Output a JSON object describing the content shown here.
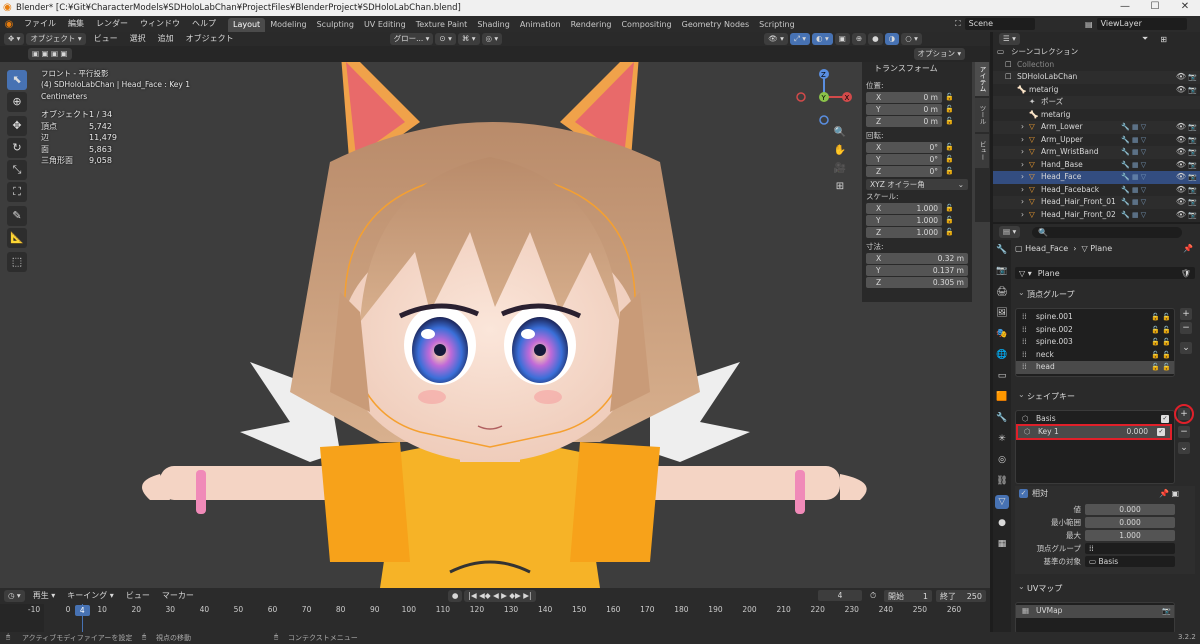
{
  "window": {
    "title": "Blender* [C:¥Git¥CharacterModels¥SDHoloLabChan¥ProjectFiles¥BlenderProject¥SDHoloLabChan.blend]",
    "minimize": "—",
    "maximize": "☐",
    "close": "✕"
  },
  "menu": {
    "items": [
      "ファイル",
      "編集",
      "レンダー",
      "ウィンドウ",
      "ヘルプ"
    ],
    "workspaces": [
      "Layout",
      "Modeling",
      "Sculpting",
      "UV Editing",
      "Texture Paint",
      "Shading",
      "Animation",
      "Rendering",
      "Compositing",
      "Geometry Nodes",
      "Scripting"
    ],
    "active_workspace": "Layout",
    "scene": "Scene",
    "view_layer": "ViewLayer"
  },
  "viewport_header": {
    "mode": "オブジェクト ▾",
    "menus": [
      "ビュー",
      "選択",
      "追加",
      "オブジェクト"
    ],
    "orientation": "グロー... ▾",
    "options": "オプション ▾"
  },
  "viewport_overlay": {
    "view_name": "フロント - 平行投影",
    "context": "(4) SDHoloLabChan | Head_Face : Key 1",
    "units": "Centimeters",
    "stats": [
      {
        "label": "オブジェクト",
        "value": "1 / 34"
      },
      {
        "label": "頂点",
        "value": "5,742"
      },
      {
        "label": "辺",
        "value": "11,479"
      },
      {
        "label": "面",
        "value": "5,863"
      },
      {
        "label": "三角形面",
        "value": "9,058"
      }
    ],
    "gizmo": {
      "x": "X",
      "y": "Y",
      "z": "Z"
    }
  },
  "transform_panel": {
    "title": "トランスフォーム",
    "location_label": "位置:",
    "location": [
      {
        "axis": "X",
        "value": "0 m"
      },
      {
        "axis": "Y",
        "value": "0 m"
      },
      {
        "axis": "Z",
        "value": "0 m"
      }
    ],
    "rotation_label": "回転:",
    "rotation": [
      {
        "axis": "X",
        "value": "0°"
      },
      {
        "axis": "Y",
        "value": "0°"
      },
      {
        "axis": "Z",
        "value": "0°"
      }
    ],
    "rotation_mode": "XYZ オイラー角",
    "scale_label": "スケール:",
    "scale": [
      {
        "axis": "X",
        "value": "1.000"
      },
      {
        "axis": "Y",
        "value": "1.000"
      },
      {
        "axis": "Z",
        "value": "1.000"
      }
    ],
    "dimensions_label": "寸法:",
    "dimensions": [
      {
        "axis": "X",
        "value": "0.32 m"
      },
      {
        "axis": "Y",
        "value": "0.137 m"
      },
      {
        "axis": "Z",
        "value": "0.305 m"
      }
    ]
  },
  "side_tabs": [
    "アイテム",
    "ツール",
    "ビュー"
  ],
  "outliner": {
    "root": "シーンコレクション",
    "rows": [
      {
        "name": "Collection",
        "indent": 1,
        "dim": true
      },
      {
        "name": "SDHoloLabChan",
        "indent": 1,
        "dim": false
      },
      {
        "name": "metarig",
        "indent": 2,
        "dim": false
      },
      {
        "name": "ポーズ",
        "indent": 3,
        "dim": false
      },
      {
        "name": "metarig",
        "indent": 3,
        "dim": false
      },
      {
        "name": "Arm_Lower",
        "indent": 3,
        "dim": false
      },
      {
        "name": "Arm_Upper",
        "indent": 3,
        "dim": false
      },
      {
        "name": "Arm_WristBand",
        "indent": 3,
        "dim": false
      },
      {
        "name": "Hand_Base",
        "indent": 3,
        "dim": false
      },
      {
        "name": "Head_Face",
        "indent": 3,
        "dim": false,
        "selected": true
      },
      {
        "name": "Head_Faceback",
        "indent": 3,
        "dim": false
      },
      {
        "name": "Head_Hair_Front_01",
        "indent": 3,
        "dim": false
      },
      {
        "name": "Head_Hair_Front_02",
        "indent": 3,
        "dim": false
      }
    ]
  },
  "properties": {
    "object_name": "Head_Face",
    "mesh_name": "Plane",
    "datablock": "Plane",
    "vertex_groups_title": "頂点グループ",
    "vertex_groups": [
      "spine.001",
      "spine.002",
      "spine.003",
      "neck",
      "head"
    ],
    "shape_keys_title": "シェイプキー",
    "shape_keys": [
      {
        "name": "Basis",
        "value": ""
      },
      {
        "name": "Key 1",
        "value": "0.000"
      }
    ],
    "relative_label": "相対",
    "fields": [
      {
        "label": "値",
        "value": "0.000"
      },
      {
        "label": "最小範囲",
        "value": "0.000"
      },
      {
        "label": "最大",
        "value": "1.000"
      }
    ],
    "vertex_group_label": "頂点グループ",
    "relative_to_label": "基準の対象",
    "relative_to_value": "Basis",
    "uv_maps_title": "UVマップ",
    "uv_maps": [
      "UVMap"
    ]
  },
  "timeline": {
    "menus": [
      "再生 ▾",
      "キーイング ▾",
      "ビュー",
      "マーカー"
    ],
    "current_frame": "4",
    "start_label": "開始",
    "start": "1",
    "end_label": "終了",
    "end": "250",
    "ticks": [
      "-10",
      "0",
      "10",
      "20",
      "30",
      "40",
      "50",
      "60",
      "70",
      "80",
      "90",
      "100",
      "110",
      "120",
      "130",
      "140",
      "150",
      "160",
      "170",
      "180",
      "190",
      "200",
      "210",
      "220",
      "230",
      "240",
      "250",
      "260"
    ],
    "playhead_label": "4"
  },
  "statusbar": {
    "left": "アクティブモディファイアーを設定",
    "middle": "視点の移動",
    "right": "コンテクストメニュー",
    "version": "3.2.2"
  },
  "colors": {
    "accent": "#4772b3",
    "highlight_red": "#e0202a",
    "selection_outline": "#f5a030"
  }
}
